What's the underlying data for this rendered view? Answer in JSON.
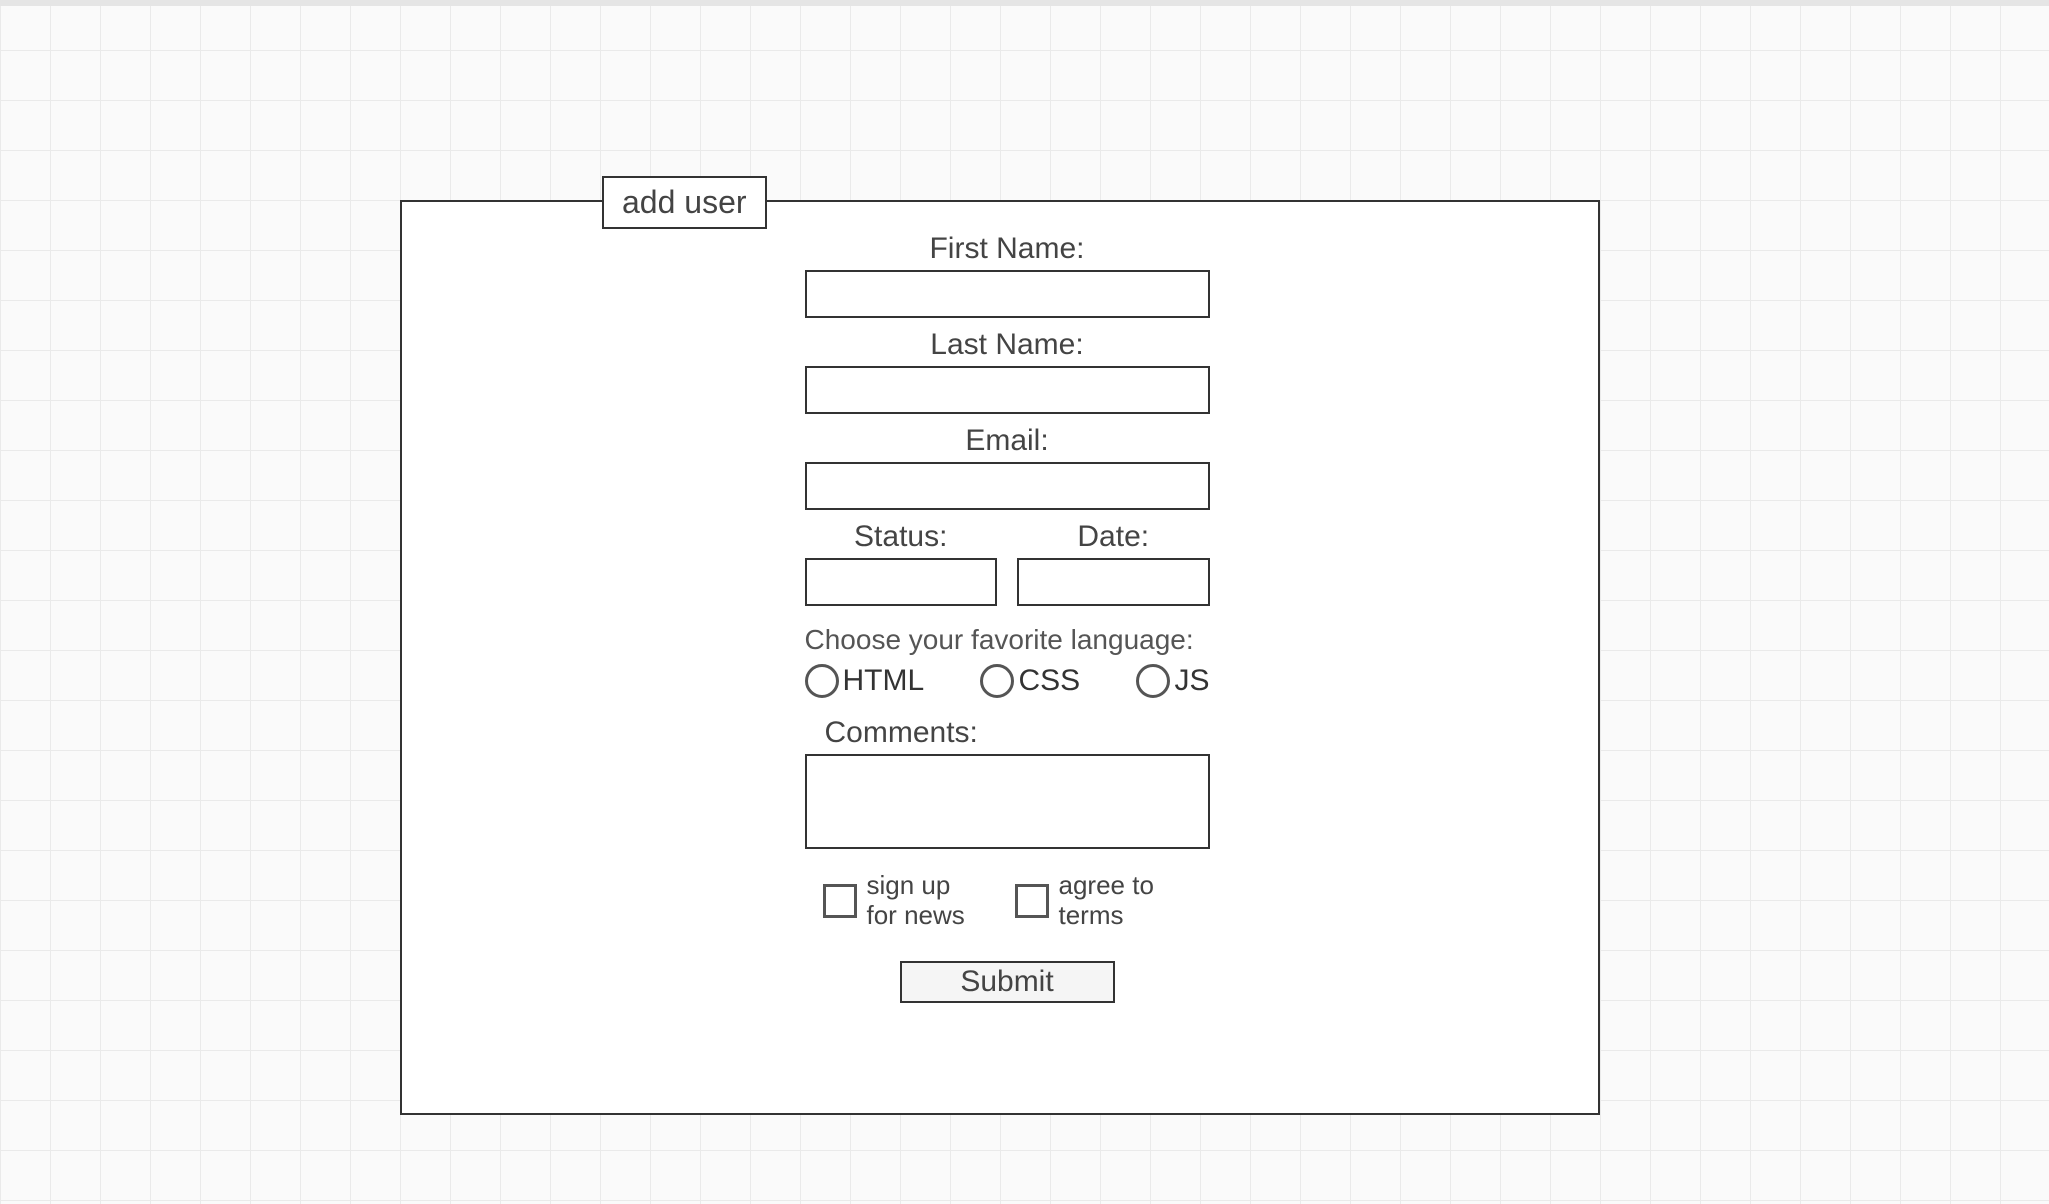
{
  "form": {
    "legend": "add user",
    "fields": {
      "first_name": {
        "label": "First Name:",
        "value": ""
      },
      "last_name": {
        "label": "Last Name:",
        "value": ""
      },
      "email": {
        "label": "Email:",
        "value": ""
      },
      "status": {
        "label": "Status:",
        "value": ""
      },
      "date": {
        "label": "Date:",
        "value": ""
      },
      "comments": {
        "label": "Comments:",
        "value": ""
      }
    },
    "radios": {
      "label": "Choose your favorite language:",
      "options": [
        {
          "label": "HTML"
        },
        {
          "label": "CSS"
        },
        {
          "label": "JS"
        }
      ]
    },
    "checkboxes": [
      {
        "label": "sign up for news"
      },
      {
        "label": "agree to terms"
      }
    ],
    "submit_label": "Submit"
  }
}
